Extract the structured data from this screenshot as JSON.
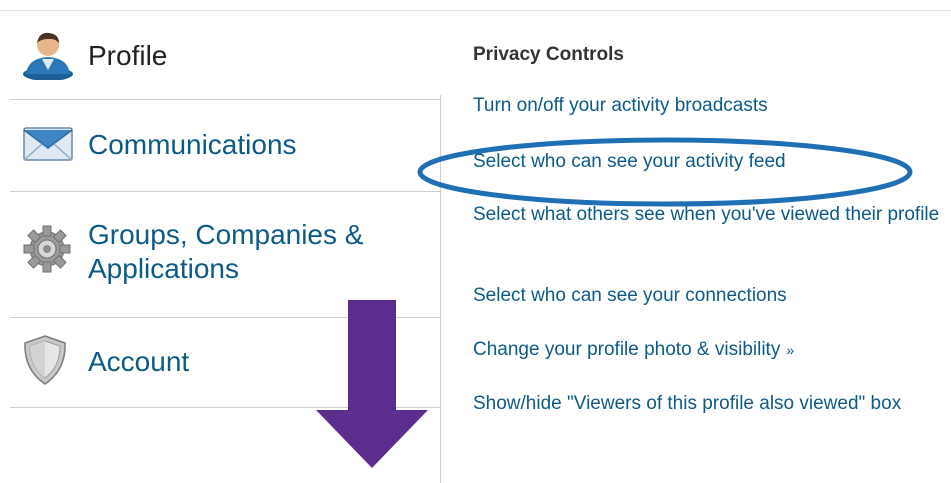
{
  "sidebar": {
    "items": [
      {
        "label": "Profile",
        "icon": "user-profile-icon",
        "active": true
      },
      {
        "label": "Communications",
        "icon": "envelope-icon",
        "active": false
      },
      {
        "label": "Groups, Companies &\nApplications",
        "icon": "gear-icon",
        "active": false
      },
      {
        "label": "Account",
        "icon": "shield-icon",
        "active": false
      }
    ]
  },
  "main": {
    "section_title": "Privacy Controls",
    "links": [
      "Turn on/off your activity broadcasts",
      "Select who can see your activity feed",
      "Select what others see when you've viewed their profile",
      "Select who can see your connections",
      "Change your profile photo & visibility",
      "Show/hide \"Viewers of this profile also viewed\" box"
    ],
    "link_suffix_glyph": "»"
  },
  "annotations": {
    "highlight_color": "#1f6fb5",
    "arrow_color": "#5b2d8e"
  }
}
